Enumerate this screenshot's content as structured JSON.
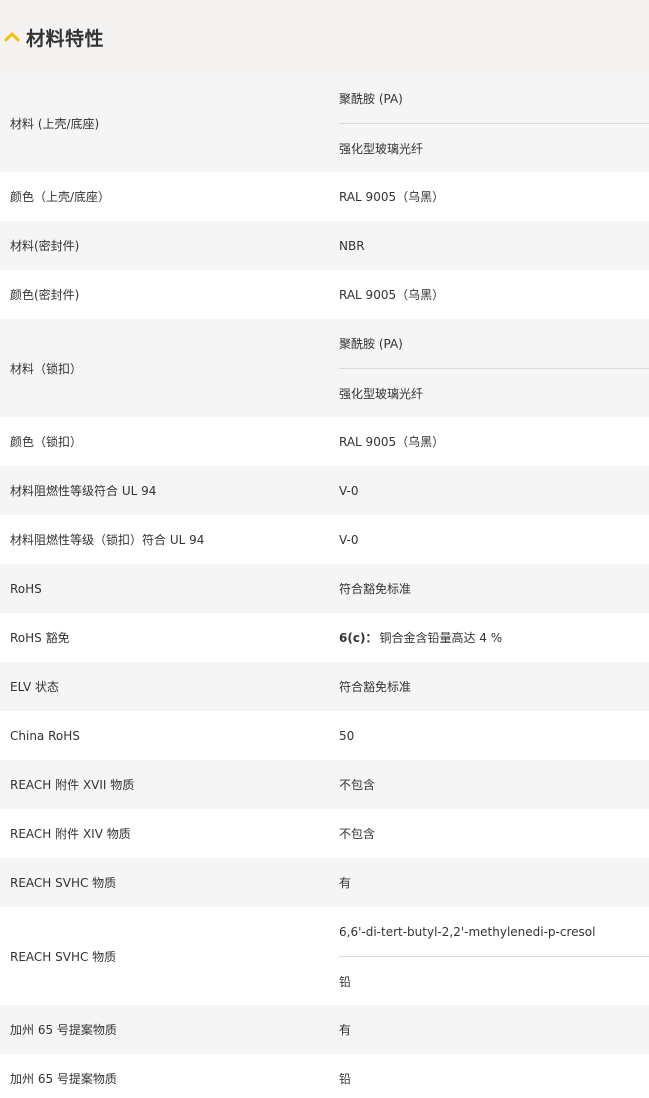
{
  "header": {
    "title": "材料特性",
    "toggle_icon": "chevron-up-icon",
    "accent_color": "#f2c200"
  },
  "rows": [
    {
      "key": "材料 (上壳/底座)",
      "values": [
        "聚酰胺 (PA)",
        "强化型玻璃光纤"
      ]
    },
    {
      "key": "颜色（上壳/底座）",
      "values": [
        "RAL 9005（乌黑）"
      ]
    },
    {
      "key": "材料(密封件)",
      "values": [
        "NBR"
      ]
    },
    {
      "key": "颜色(密封件)",
      "values": [
        "RAL 9005（乌黑）"
      ]
    },
    {
      "key": "材料（锁扣）",
      "values": [
        "聚酰胺 (PA)",
        "强化型玻璃光纤"
      ]
    },
    {
      "key": "颜色（锁扣）",
      "values": [
        "RAL 9005（乌黑）"
      ]
    },
    {
      "key": "材料阻燃性等级符合 UL 94",
      "values": [
        "V-0"
      ]
    },
    {
      "key": "材料阻燃性等级（锁扣）符合 UL 94",
      "values": [
        "V-0"
      ]
    },
    {
      "key": "RoHS",
      "values": [
        "符合豁免标准"
      ]
    },
    {
      "key": "RoHS 豁免",
      "values": [
        "6(c)：铜合金含铅量高达 4 %"
      ],
      "bold_prefix": "6(c)："
    },
    {
      "key": "ELV 状态",
      "values": [
        "符合豁免标准"
      ]
    },
    {
      "key": "China RoHS",
      "values": [
        "50"
      ]
    },
    {
      "key": "REACH 附件 XVII 物质",
      "values": [
        "不包含"
      ]
    },
    {
      "key": "REACH 附件 XIV 物质",
      "values": [
        "不包含"
      ]
    },
    {
      "key": "REACH SVHC 物质",
      "values": [
        "有"
      ]
    },
    {
      "key": "REACH SVHC 物质",
      "values": [
        "6,6'-di-tert-butyl-2,2'-methylenedi-p-cresol",
        "铅"
      ]
    },
    {
      "key": "加州 65 号提案物质",
      "values": [
        "有"
      ]
    },
    {
      "key": "加州 65 号提案物质",
      "values": [
        "铅"
      ]
    }
  ]
}
